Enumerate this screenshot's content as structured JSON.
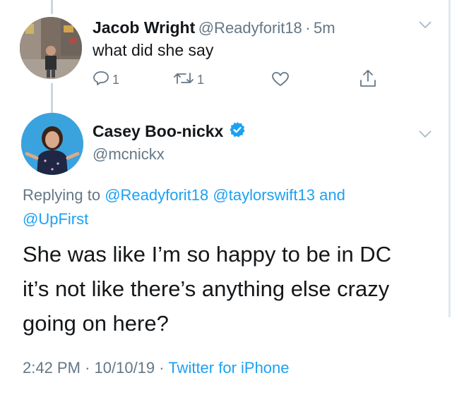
{
  "tweet1": {
    "author_name": "Jacob Wright",
    "author_handle": "@Readyforit18",
    "separator": "·",
    "time": "5m",
    "text": "what did she say",
    "reply_count": "1",
    "retweet_count": "1"
  },
  "tweet2": {
    "author_name": "Casey Boo-nickx",
    "author_handle": "@mcnickx",
    "verified": true,
    "replying_prefix": "Replying to",
    "replying_to": [
      "@Readyforit18",
      "@taylorswift13"
    ],
    "replying_and": "and",
    "replying_last": "@UpFirst",
    "body_lines": [
      "She was like I’m so happy to be in DC",
      "it’s not like there’s anything else crazy",
      "going on here?"
    ],
    "time": "2:42 PM",
    "date": "10/10/19",
    "separator": "·",
    "source": "Twitter for iPhone"
  },
  "colors": {
    "link": "#1da1f2",
    "muted": "#657786",
    "text": "#14171a",
    "verified": "#1da1f2"
  },
  "icons": [
    "reply-icon",
    "retweet-icon",
    "like-icon",
    "share-icon",
    "chevron-down-icon",
    "verified-badge-icon"
  ]
}
